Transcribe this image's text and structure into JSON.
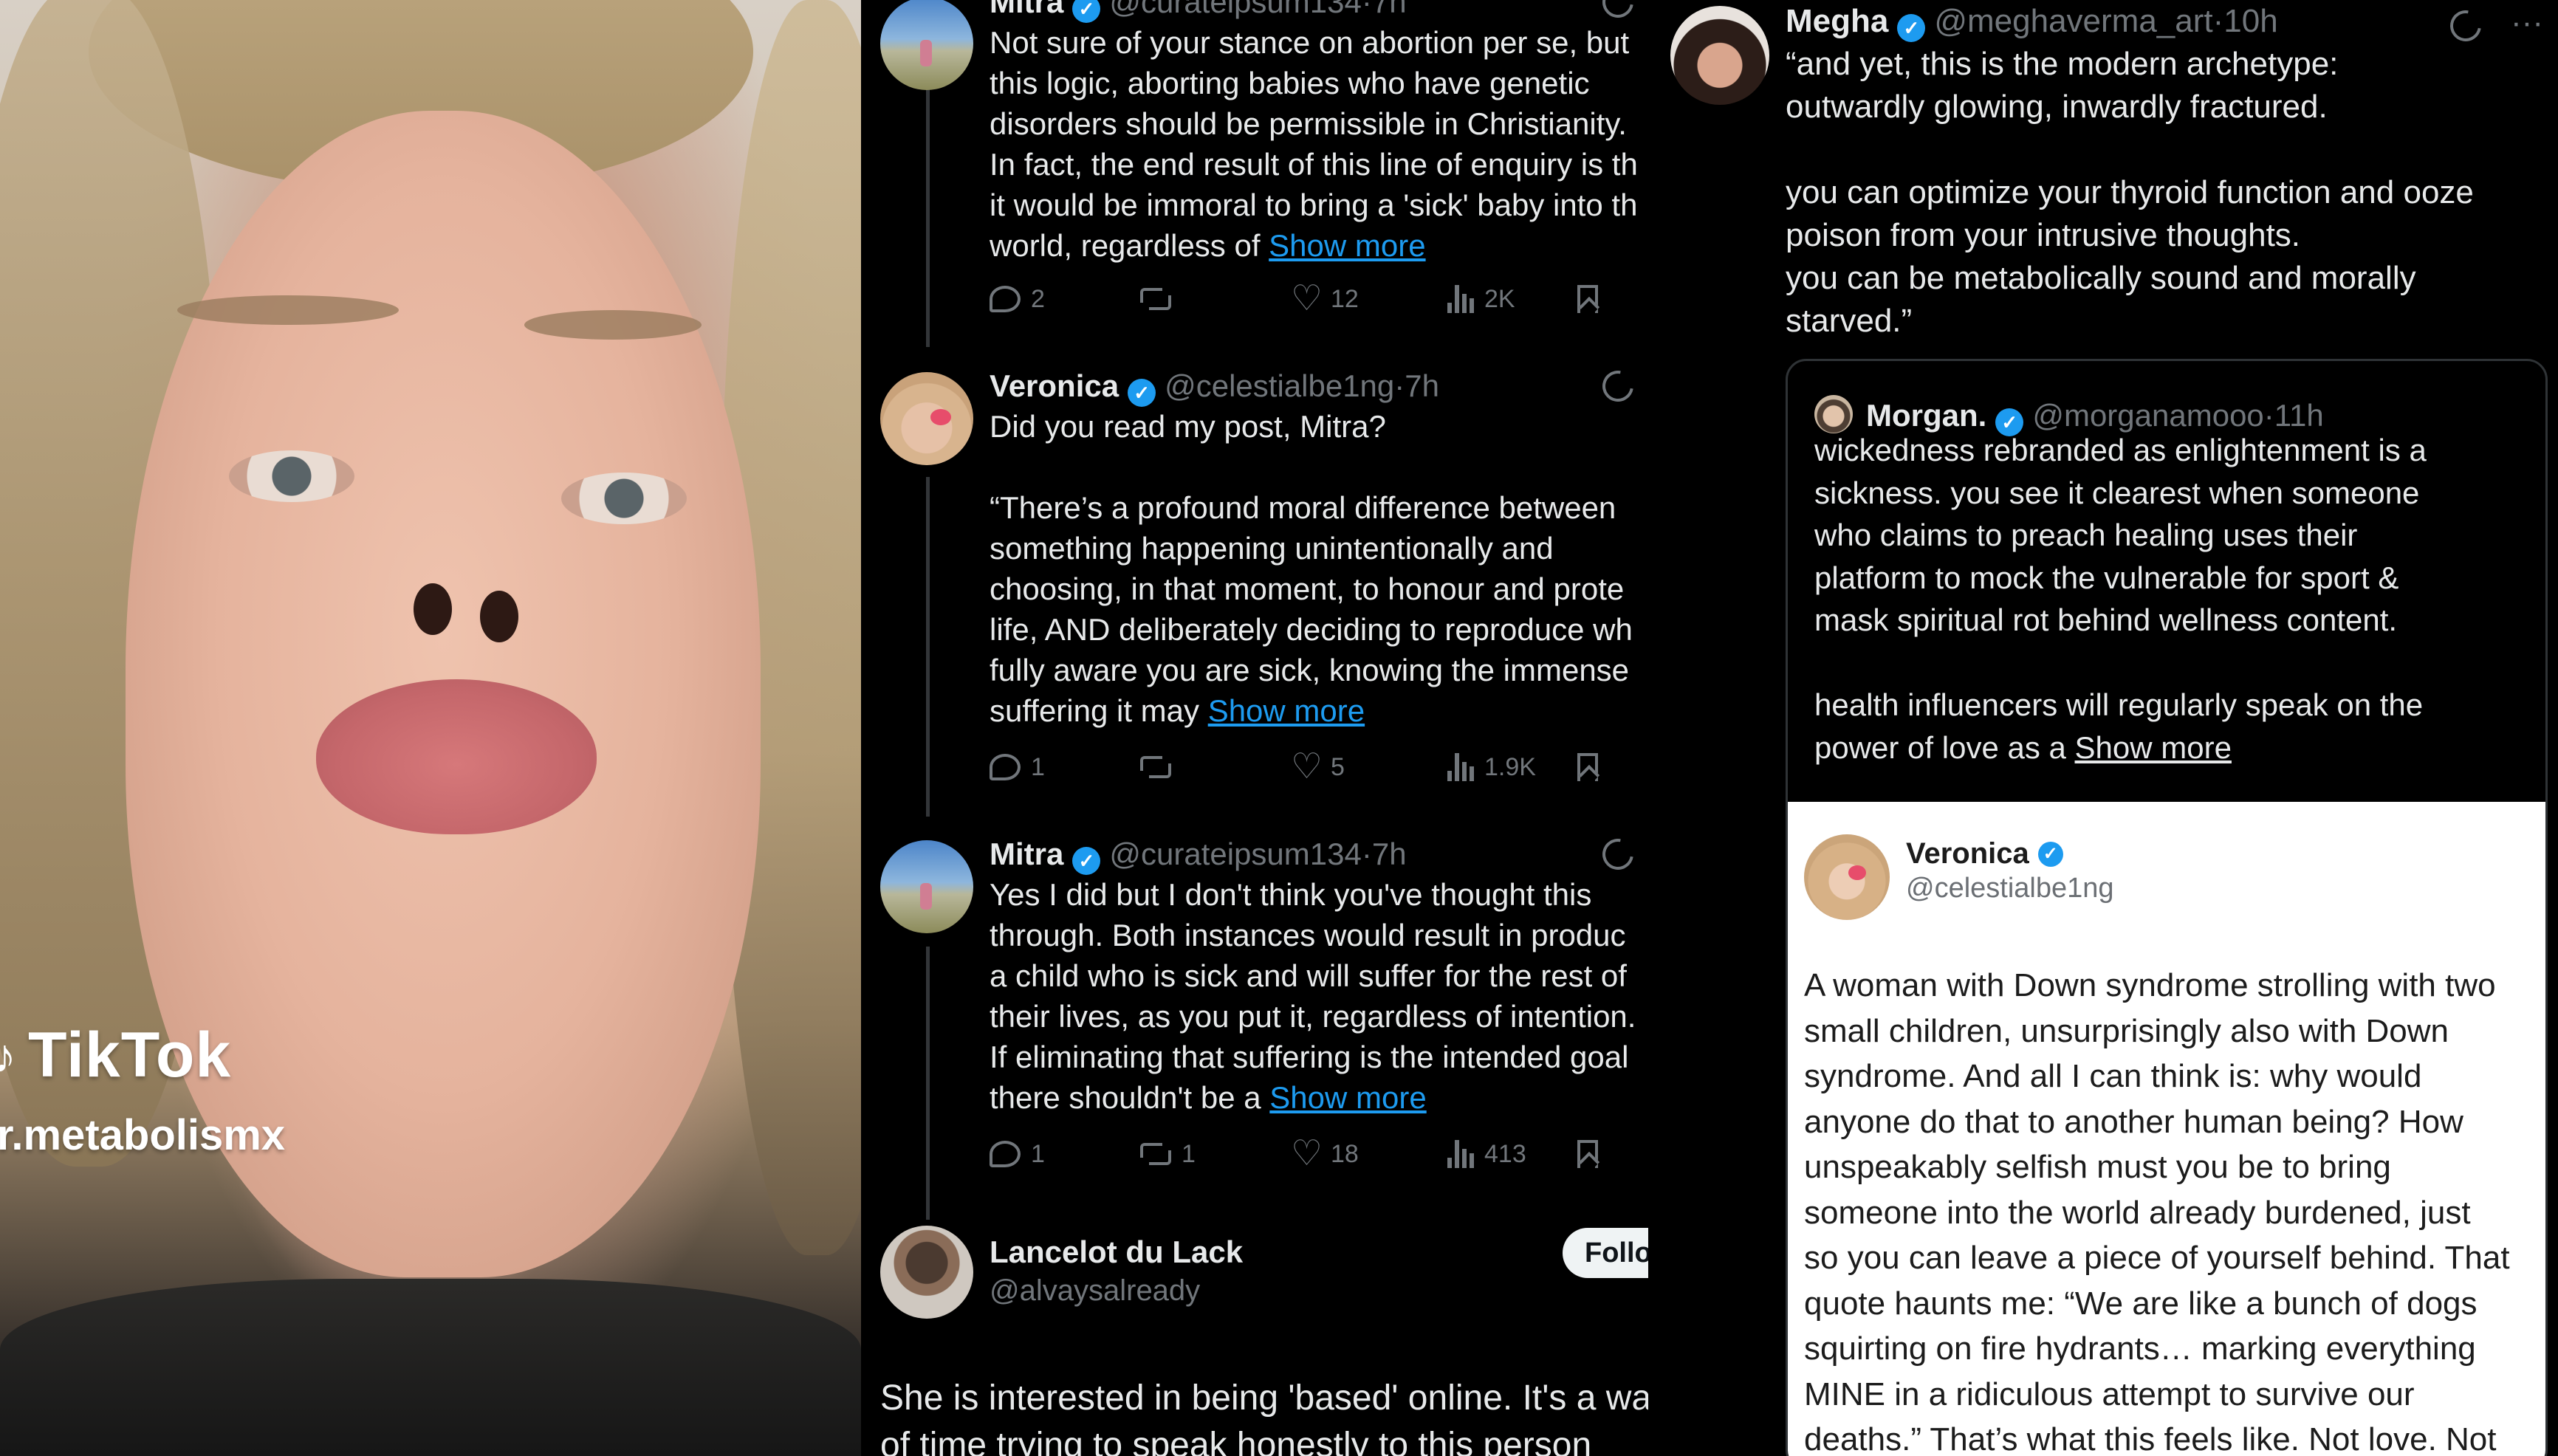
{
  "tiktok": {
    "brand": "TikTok",
    "username": "r.metabolismx"
  },
  "thread": {
    "tweets": [
      {
        "name": "Mitra",
        "handle": "@curateipsum134",
        "time": "7h",
        "text": "Not sure of your stance on abortion per se, but\nthis logic, aborting babies who have genetic\ndisorders should be permissible in Christianity.\nIn fact, the end result of this line of enquiry is th\nit would be immoral to bring a 'sick' baby into th\nworld, regardless of ",
        "show_more": "Show more",
        "replies": "2",
        "reposts": "",
        "likes": "12",
        "views": "2K"
      },
      {
        "name": "Veronica",
        "handle": "@celestialbe1ng",
        "time": "7h",
        "text": "Did you read my post, Mitra?\n\n“There’s a profound moral difference between\nsomething happening unintentionally and\nchoosing, in that moment, to honour and prote\nlife, AND deliberately deciding to reproduce wh\nfully aware you are sick, knowing the immense\nsuffering it may ",
        "show_more": "Show more",
        "replies": "1",
        "reposts": "",
        "likes": "5",
        "views": "1.9K"
      },
      {
        "name": "Mitra",
        "handle": "@curateipsum134",
        "time": "7h",
        "text": "Yes I did but I don't think you've thought this\nthrough. Both instances would result in produc\na child who is sick and will suffer for the rest of\ntheir lives, as you put it, regardless of intention.\nIf eliminating that suffering is the intended goal\nthere shouldn't be a ",
        "show_more": "Show more",
        "replies": "1",
        "reposts": "1",
        "likes": "18",
        "views": "413"
      }
    ],
    "lancelot": {
      "name": "Lancelot du Lack",
      "handle": "@alvaysalready",
      "follow_label": "Follo",
      "text": "She is interested in being 'based' online. It's a wa\nof time trying to speak honestly to this person"
    }
  },
  "megha": {
    "name": "Megha",
    "handle": "@meghaverma_art",
    "time": "10h",
    "text": "“and yet, this is the modern archetype:\noutwardly glowing, inwardly fractured.\n\nyou can optimize your thyroid function and ooze\npoison from your intrusive thoughts.\nyou can be metabolically sound and morally\nstarved.”",
    "more_icon": "···",
    "quote": {
      "name": "Morgan.",
      "handle": "@morganamooo",
      "time": "11h",
      "text": "wickedness rebranded as enlightenment is a\nsickness. you see it clearest when someone\nwho claims to preach healing uses their\nplatform to mock the vulnerable for sport &\nmask spiritual rot behind wellness content.\n\nhealth influencers will regularly speak on the\npower of love as a ",
      "show_more": "Show more"
    },
    "embed": {
      "name": "Veronica",
      "handle": "@celestialbe1ng",
      "text": "A woman with Down syndrome strolling with two\nsmall children, unsurprisingly also with Down\nsyndrome. And all I can think is: why would\nanyone do that to another human being? How\nunspeakably selfish must you be to bring\nsomeone into the world already burdened, just\nso you can leave a piece of yourself behind. That\nquote haunts me: “We are like a bunch of dogs\nsquirting on fire hydrants… marking everything\nMINE in a ridiculous attempt to survive our\ndeaths.” That’s what this feels like. Not love. Not"
    }
  },
  "colors": {
    "accent": "#1d9bf0",
    "muted": "#71767b",
    "background": "#000000"
  },
  "icons": [
    "tiktok-logo-icon",
    "verified-icon",
    "grok-icon",
    "reply-icon",
    "repost-icon",
    "like-icon",
    "views-icon",
    "bookmark-icon",
    "more-icon"
  ]
}
